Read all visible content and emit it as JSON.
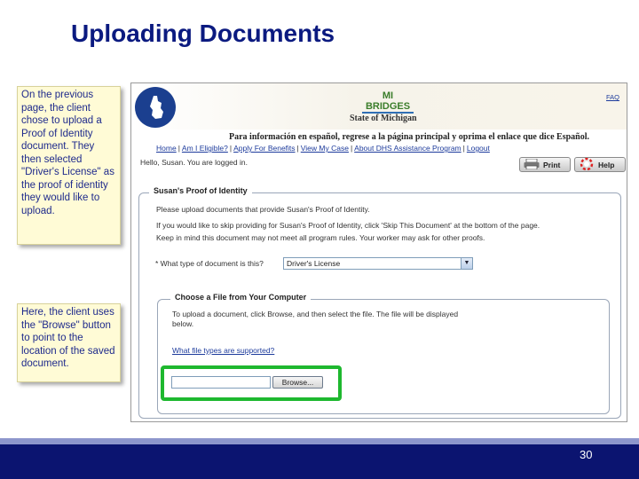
{
  "slide": {
    "title": "Uploading Documents",
    "note1": "On the previous page, the client chose to upload a Proof of Identity document. They then selected \"Driver's License\" as the proof of identity they would like to upload.",
    "note2": "Here, the client uses the \"Browse\" button to point to the location of the saved document.",
    "page_number": "30",
    "colors": {
      "title": "#0b1a80",
      "footer": "#0b1470",
      "highlight": "#1eb82f",
      "note_bg": "#fffbd6"
    }
  },
  "app": {
    "logo_text": "MI BRIDGES",
    "state_text": "State of Michigan",
    "faq_link": "FAQ",
    "spanish_notice": "Para información en español, regrese a la página principal y oprima el enlace que dice Español.",
    "nav": [
      "Home",
      "Am I Eligible?",
      "Apply For Benefits",
      "View My Case",
      "About DHS Assistance Program",
      "Logout"
    ],
    "greeting": "Hello, Susan. You are logged in.",
    "print_label": "Print",
    "help_label": "Help",
    "section": {
      "legend": "Susan's Proof of Identity",
      "line1": "Please upload documents that provide Susan's Proof of Identity.",
      "line2": "If you would like to skip providing for Susan's Proof of Identity, click 'Skip This Document' at the bottom of the page.",
      "line3": "Keep in mind this document may not meet all program rules. Your worker may ask for other proofs.",
      "question": "* What type of document is this?",
      "document_type_selected": "Driver's License"
    },
    "file_section": {
      "legend": "Choose a File from Your Computer",
      "instructions": "To upload a document, click Browse, and then select the file. The file will be displayed below.",
      "types_link": "What file types are supported?",
      "file_value": "",
      "browse_label": "Browse..."
    }
  }
}
